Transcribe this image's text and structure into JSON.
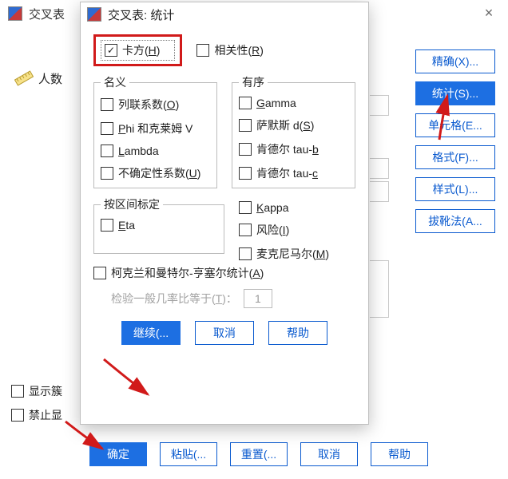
{
  "parent": {
    "title": "交叉表",
    "close_symbol": "×",
    "left_field_label": "人数",
    "side_buttons": [
      {
        "label": "精确(X)..."
      },
      {
        "label": "统计(S)...",
        "selected": true
      },
      {
        "label": "单元格(E...",
        "selected": false
      },
      {
        "label": "格式(F)..."
      },
      {
        "label": "样式(L)..."
      },
      {
        "label": "拔靴法(A..."
      }
    ],
    "bottom_checks": [
      {
        "label": "显示簇"
      },
      {
        "label": "禁止显"
      }
    ],
    "bottom": {
      "ok": "确定",
      "paste": "粘贴(...",
      "reset": "重置(...",
      "cancel": "取消",
      "help": "帮助"
    }
  },
  "child": {
    "title": "交叉表: 统计",
    "chi_square": {
      "label": "卡方(H)",
      "checked": true
    },
    "correlations": {
      "label": "相关性(R)",
      "checked": false
    },
    "nominal": {
      "legend": "名义",
      "items": [
        {
          "label": "列联系数(O)"
        },
        {
          "label": "Phi 和克莱姆 V"
        },
        {
          "label": "Lambda"
        },
        {
          "label": "不确定性系数(U)"
        }
      ]
    },
    "ordinal": {
      "legend": "有序",
      "items": [
        {
          "label": "Gamma"
        },
        {
          "label": "萨默斯 d(S)"
        },
        {
          "label": "肯德尔 tau-b"
        },
        {
          "label": "肯德尔 tau-c"
        }
      ]
    },
    "interval": {
      "legend": "按区间标定",
      "items": [
        {
          "label": "Eta"
        }
      ]
    },
    "right_group": {
      "items": [
        {
          "label": "Kappa"
        },
        {
          "label": "风险(I)"
        },
        {
          "label": "麦克尼马尔(M)"
        }
      ]
    },
    "cmh": {
      "label": "柯克兰和曼特尔-亨塞尔统计(A)",
      "odds_label": "检验一般几率比等于(T)：",
      "odds_value": "1"
    },
    "bottom": {
      "continue": "继续(...",
      "cancel": "取消",
      "help": "帮助"
    }
  },
  "colors": {
    "primary_blue": "#1d6fe2",
    "border_blue": "#0a5acf",
    "highlight_red": "#d11a1a"
  }
}
